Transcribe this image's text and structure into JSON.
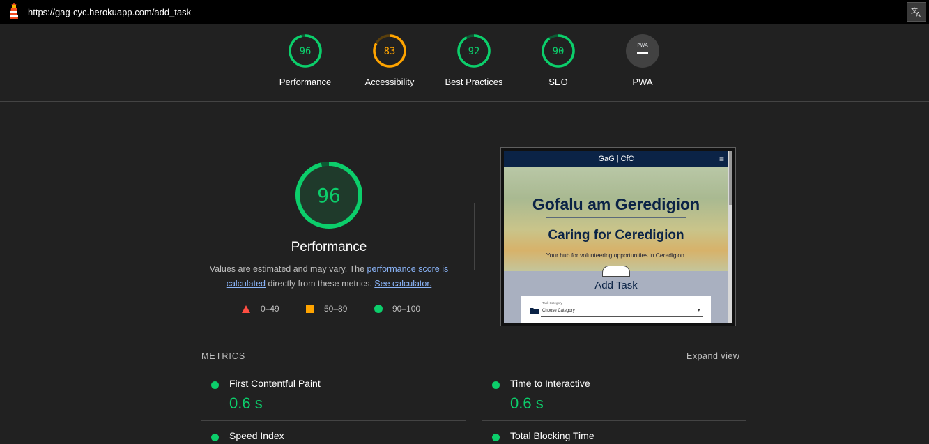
{
  "topbar": {
    "url": "https://gag-cyc.herokuapp.com/add_task"
  },
  "colors": {
    "pass": "#0cce6b",
    "average": "#ffa400",
    "fail": "#ff4e42",
    "pwa": "#5f6368"
  },
  "gauges": [
    {
      "label": "Performance",
      "score": "96",
      "value": 0.96
    },
    {
      "label": "Accessibility",
      "score": "83",
      "value": 0.83
    },
    {
      "label": "Best Practices",
      "score": "92",
      "value": 0.92
    },
    {
      "label": "SEO",
      "score": "90",
      "value": 0.9
    },
    {
      "label": "PWA",
      "badge": "PWA"
    }
  ],
  "summary": {
    "score": "96",
    "value": 0.96,
    "title": "Performance",
    "desc_before": "Values are estimated and may vary. The ",
    "desc_link1": "performance score is calculated",
    "desc_middle": " directly from these metrics. ",
    "desc_link2": "See calculator."
  },
  "legend": [
    {
      "shape": "triangle",
      "range": "0–49"
    },
    {
      "shape": "square",
      "range": "50–89"
    },
    {
      "shape": "circle",
      "range": "90–100"
    }
  ],
  "thumbnail": {
    "nav_title": "GaG | CfC",
    "heading1": "Gofalu am Geredigion",
    "heading2": "Caring for Ceredigion",
    "subtitle": "Your hub for volunteering opportunities in Ceredigion.",
    "section": "Add Task",
    "field_label": "Task Category",
    "select_value": "Choose Category"
  },
  "metrics": {
    "heading": "METRICS",
    "expand": "Expand view",
    "items": [
      {
        "name": "First Contentful Paint",
        "value": "0.6 s"
      },
      {
        "name": "Time to Interactive",
        "value": "0.6 s"
      },
      {
        "name": "Speed Index",
        "value": ""
      },
      {
        "name": "Total Blocking Time",
        "value": ""
      }
    ]
  }
}
